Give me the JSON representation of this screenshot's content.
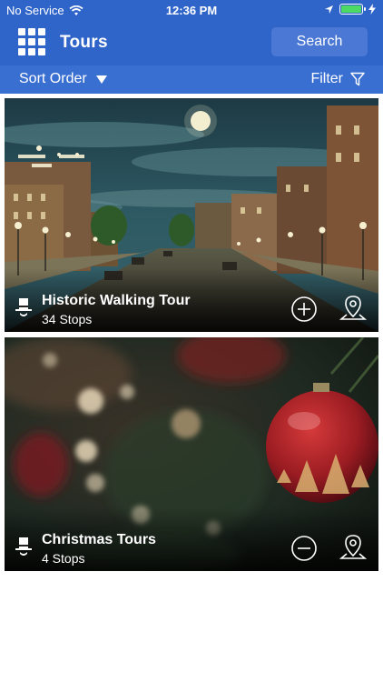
{
  "status_bar": {
    "carrier": "No Service",
    "time": "12:36 PM"
  },
  "navbar": {
    "title": "Tours",
    "search_label": "Search"
  },
  "toolbar": {
    "sort_label": "Sort Order",
    "filter_label": "Filter"
  },
  "tours": [
    {
      "title": "Historic Walking Tour",
      "stops": "34 Stops",
      "action": "add"
    },
    {
      "title": "Christmas Tours",
      "stops": "4 Stops",
      "action": "remove"
    }
  ],
  "colors": {
    "header_bg": "#2f64c9",
    "sortbar_bg": "#3a6fd2",
    "search_bg": "#4a78d4",
    "battery": "#4cd964"
  }
}
